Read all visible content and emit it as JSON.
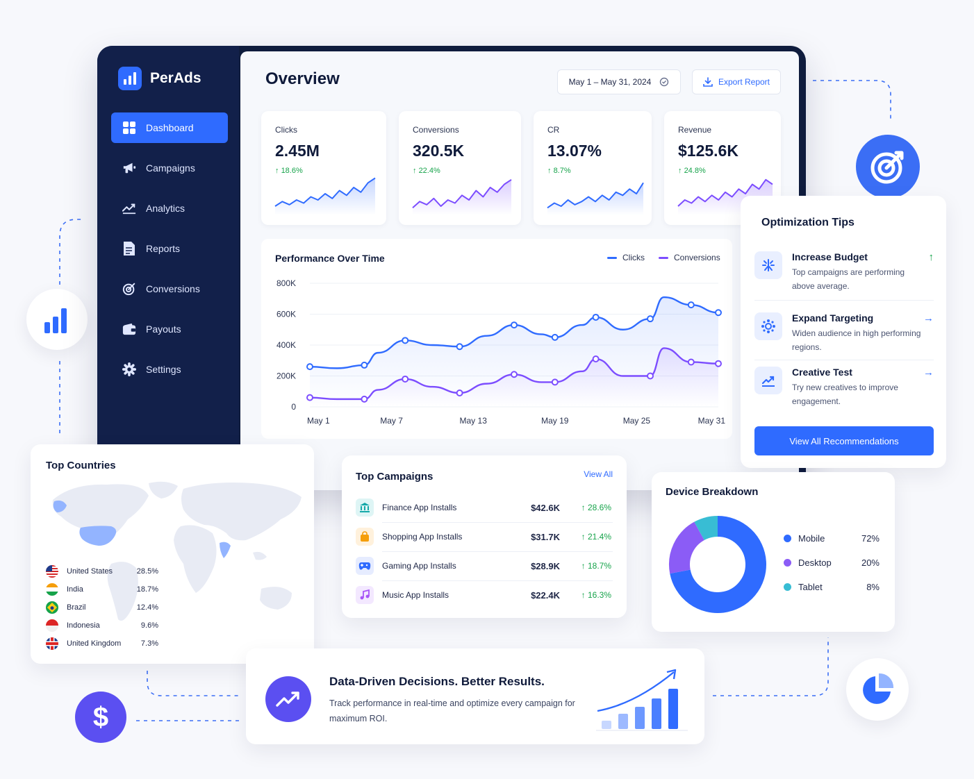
{
  "brand": {
    "name": "PerAds"
  },
  "sidebar": {
    "items": [
      {
        "label": "Dashboard",
        "icon": "dashboard-icon",
        "active": true
      },
      {
        "label": "Campaigns",
        "icon": "megaphone-icon"
      },
      {
        "label": "Analytics",
        "icon": "analytics-icon"
      },
      {
        "label": "Reports",
        "icon": "report-icon"
      },
      {
        "label": "Conversions",
        "icon": "target-icon"
      },
      {
        "label": "Payouts",
        "icon": "wallet-icon"
      },
      {
        "label": "Settings",
        "icon": "gear-icon"
      }
    ]
  },
  "header": {
    "title": "Overview",
    "date_range": "May 1 – May 31, 2024",
    "export_label": "Export Report"
  },
  "kpis": [
    {
      "label": "Clicks",
      "value": "2.45M",
      "delta": "18.6%",
      "color": "#2f6bff",
      "spark": [
        22,
        28,
        24,
        30,
        26,
        34,
        30,
        38,
        32,
        42,
        36,
        46,
        40,
        52,
        58
      ]
    },
    {
      "label": "Conversions",
      "value": "320.5K",
      "delta": "22.4%",
      "color": "#7c4dff",
      "spark": [
        20,
        28,
        24,
        32,
        22,
        30,
        26,
        36,
        30,
        42,
        34,
        46,
        40,
        50,
        56
      ]
    },
    {
      "label": "CR",
      "value": "13.07%",
      "delta": "8.7%",
      "color": "#2f6bff",
      "spark": [
        20,
        26,
        22,
        30,
        24,
        28,
        34,
        28,
        36,
        30,
        40,
        36,
        44,
        38,
        52
      ]
    },
    {
      "label": "Revenue",
      "value": "$125.6K",
      "delta": "24.8%",
      "color": "#7c4dff",
      "spark": [
        22,
        30,
        26,
        34,
        28,
        36,
        30,
        40,
        34,
        44,
        38,
        50,
        44,
        56,
        50
      ]
    }
  ],
  "performance": {
    "title": "Performance Over Time",
    "legend": {
      "clicks": "Clicks",
      "conversions": "Conversions"
    },
    "colors": {
      "clicks": "#2f6bff",
      "conversions": "#7c4dff"
    }
  },
  "chart_data": {
    "type": "line",
    "x_ticks": [
      "May 1",
      "May 7",
      "May 13",
      "May 19",
      "May 25",
      "May 31"
    ],
    "y_ticks": [
      "800K",
      "600K",
      "400K",
      "200K",
      "0"
    ],
    "ylim": [
      0,
      800000
    ],
    "grid": true,
    "legend_position": "top-right",
    "x": [
      1,
      3,
      5,
      6,
      8,
      10,
      12,
      14,
      16,
      18,
      19,
      21,
      22,
      24,
      26,
      27,
      29,
      31
    ],
    "series": [
      {
        "name": "Clicks",
        "values": [
          260000,
          250000,
          270000,
          350000,
          430000,
          400000,
          390000,
          460000,
          530000,
          470000,
          450000,
          530000,
          580000,
          500000,
          570000,
          710000,
          660000,
          610000
        ]
      },
      {
        "name": "Conversions",
        "values": [
          60000,
          50000,
          50000,
          110000,
          180000,
          130000,
          90000,
          150000,
          210000,
          160000,
          160000,
          230000,
          310000,
          200000,
          200000,
          380000,
          290000,
          280000
        ]
      }
    ]
  },
  "tips": {
    "title": "Optimization Tips",
    "items": [
      {
        "title": "Increase Budget",
        "desc": "Top campaigns are performing above average.",
        "icon": "budget-icon",
        "arrow": "↑",
        "arrow_color": "#16a34a"
      },
      {
        "title": "Expand Targeting",
        "desc": "Widen audience in high performing regions.",
        "icon": "targeting-icon",
        "arrow": "→",
        "arrow_color": "#2f6bff"
      },
      {
        "title": "Creative Test",
        "desc": "Try new creatives to improve engagement.",
        "icon": "trend-icon",
        "arrow": "→",
        "arrow_color": "#2f6bff"
      }
    ],
    "button": "View All Recommendations"
  },
  "countries": {
    "title": "Top Countries",
    "rows": [
      {
        "name": "United States",
        "pct": "28.5%",
        "flag": "us-flag-icon"
      },
      {
        "name": "India",
        "pct": "18.7%",
        "flag": "india-flag-icon"
      },
      {
        "name": "Brazil",
        "pct": "12.4%",
        "flag": "brazil-flag-icon"
      },
      {
        "name": "Indonesia",
        "pct": "9.6%",
        "flag": "indonesia-flag-icon"
      },
      {
        "name": "United Kingdom",
        "pct": "7.3%",
        "flag": "uk-flag-icon"
      }
    ]
  },
  "campaigns": {
    "title": "Top Campaigns",
    "view_all": "View All",
    "rows": [
      {
        "name": "Finance App Installs",
        "value": "$42.6K",
        "delta": "28.6%",
        "icon": "bank-icon",
        "bg": "#def5f5",
        "fg": "#14a8a8"
      },
      {
        "name": "Shopping App Installs",
        "value": "$31.7K",
        "delta": "21.4%",
        "icon": "shopping-bag-icon",
        "bg": "#fff1dc",
        "fg": "#f59e0b"
      },
      {
        "name": "Gaming App Installs",
        "value": "$28.9K",
        "delta": "18.7%",
        "icon": "gamepad-icon",
        "bg": "#e6ecff",
        "fg": "#2f6bff"
      },
      {
        "name": "Music App Installs",
        "value": "$22.4K",
        "delta": "16.3%",
        "icon": "music-note-icon",
        "bg": "#f3e8ff",
        "fg": "#a855f7"
      }
    ]
  },
  "devices": {
    "title": "Device Breakdown",
    "rows": [
      {
        "name": "Mobile",
        "pct": "72%",
        "value": 72,
        "color": "#2f6bff"
      },
      {
        "name": "Desktop",
        "pct": "20%",
        "value": 20,
        "color": "#8b5cf6"
      },
      {
        "name": "Tablet",
        "pct": "8%",
        "value": 8,
        "color": "#38bdd4"
      }
    ]
  },
  "promo": {
    "title": "Data-Driven Decisions. Better Results.",
    "text": "Track performance in real-time and optimize every campaign for maximum ROI."
  }
}
